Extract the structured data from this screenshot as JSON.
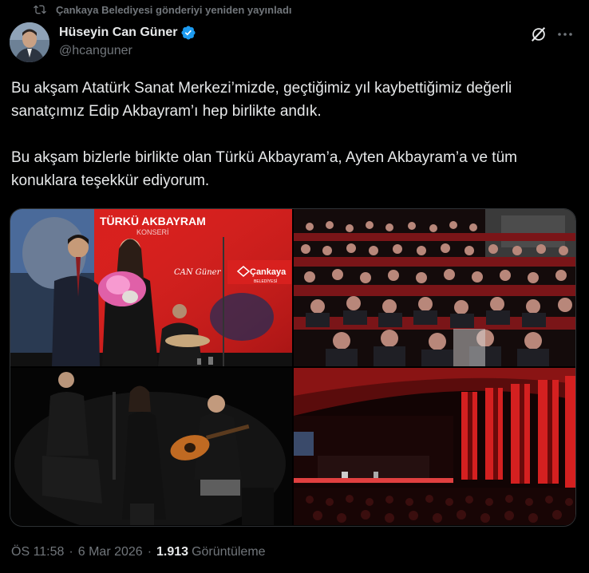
{
  "repost": {
    "text": "Çankaya Belediyesi gönderiyi yeniden yayınladı"
  },
  "author": {
    "name": "Hüseyin Can Güner",
    "handle": "@hcanguner"
  },
  "tweet": {
    "paragraphs": [
      "Bu akşam Atatürk Sanat Merkezi’mizde, geçtiğimiz yıl kaybettiğimiz değerli sanatçımız Edip Akbayram’ı hep birlikte andık.",
      "Bu akşam bizlerle birlikte olan Türkü Akbayram’a, Ayten Akbayram’a ve tüm konuklara teşekkür ediyorum."
    ]
  },
  "media": {
    "photo1": {
      "banner_title": "TÜRKÜ AKBAYRAM",
      "banner_sub": "KONSERİ",
      "sponsor": "Çankaya",
      "sponsor_sub": "BELEDİYESİ",
      "script_text": "CAN Güner"
    }
  },
  "meta": {
    "time": "ÖS 11:58",
    "date": "6 Mar 2026",
    "views": "1.913",
    "views_label": "Görüntüleme"
  },
  "colors": {
    "background": "#000000",
    "text": "#e7e9ea",
    "muted": "#71767b",
    "verified": "#1d9bf0",
    "border": "#2f3336"
  },
  "icons": {
    "repost": "repost-icon",
    "verified": "verified-badge-icon",
    "grok": "grok-icon",
    "more": "more-icon"
  }
}
